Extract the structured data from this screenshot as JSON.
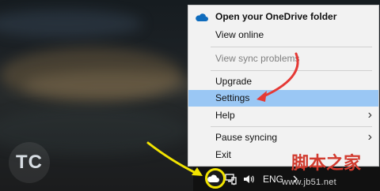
{
  "menu": {
    "items": [
      {
        "label": "Open your OneDrive folder"
      },
      {
        "label": "View online"
      },
      {
        "label": "View sync problems"
      },
      {
        "label": "Upgrade"
      },
      {
        "label": "Settings"
      },
      {
        "label": "Help"
      },
      {
        "label": "Pause syncing"
      },
      {
        "label": "Exit"
      }
    ],
    "icons": {
      "onedrive": "onedrive-cloud-icon"
    }
  },
  "taskbar": {
    "language": "ENG",
    "icons": {
      "cloud": "onedrive-tray-icon",
      "network": "network-icon",
      "volume": "volume-icon",
      "chevron": "chevron-icon"
    }
  },
  "branding": {
    "logo_text": "TC"
  },
  "watermark": {
    "title": "脚本之家",
    "url": "www.jb51.net"
  },
  "colors": {
    "menu_background": "#f2f2f2",
    "selection": "#9ac7f4",
    "disabled_text": "#808080",
    "annotation_red": "#e53935",
    "annotation_yellow": "#f2e400",
    "watermark_red": "#d13b2f"
  }
}
